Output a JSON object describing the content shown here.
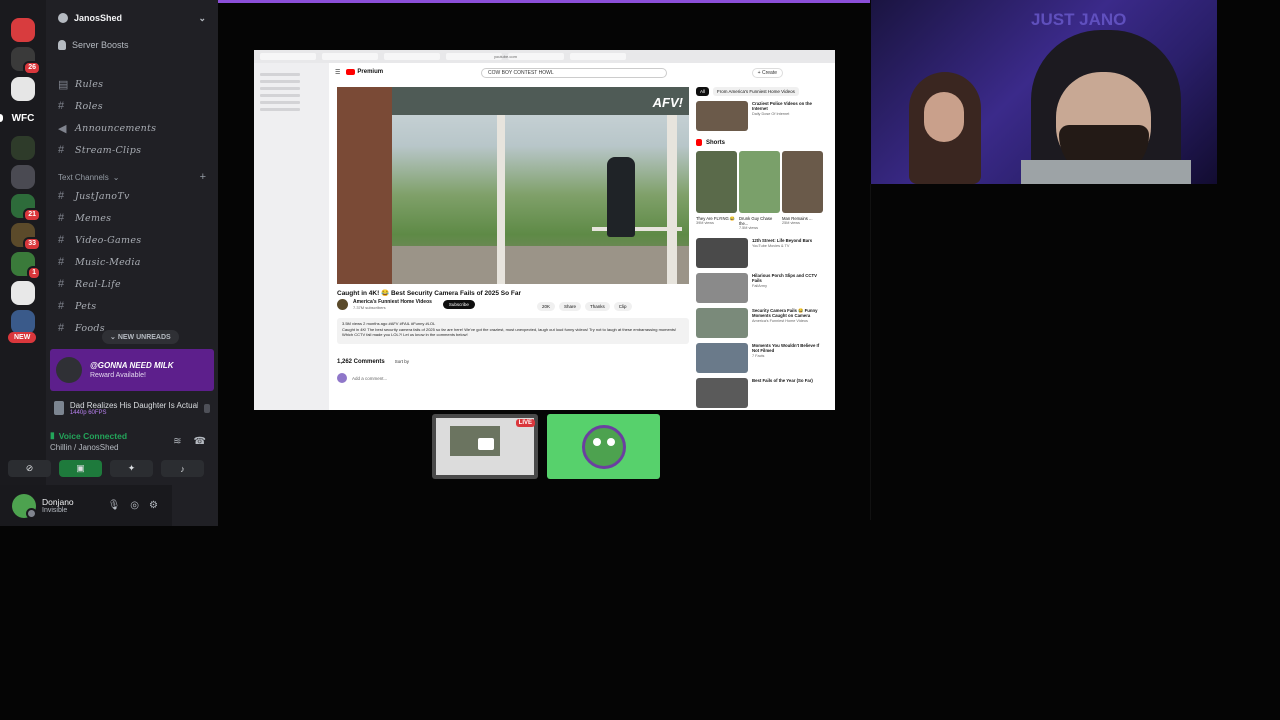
{
  "rail": {
    "servers": [
      {
        "label": "",
        "color": "#d83c3e",
        "badge": ""
      },
      {
        "label": "",
        "color": "#3a3a3a",
        "badge": "26"
      },
      {
        "label": "",
        "color": "#e6e6e6",
        "badge": ""
      },
      {
        "label": "WFC",
        "color": "#1a1a1e",
        "badge": ""
      },
      {
        "label": "",
        "color": "#2e3b2a",
        "badge": ""
      },
      {
        "label": "",
        "color": "#4a4a52",
        "badge": ""
      },
      {
        "label": "",
        "color": "#2d6b3a",
        "badge": "21"
      },
      {
        "label": "",
        "color": "#5b4a2a",
        "badge": "33"
      },
      {
        "label": "",
        "color": "#3a7a3a",
        "badge": "1"
      },
      {
        "label": "",
        "color": "#e8e8e8",
        "badge": ""
      },
      {
        "label": "",
        "color": "#3a5a8a",
        "badge": ""
      }
    ],
    "new_tag": "NEW"
  },
  "sidebar": {
    "server_name": "JanosShed",
    "boosts": "Server Boosts",
    "channels_top": [
      "Rules",
      "Roles",
      "Announcements",
      "Stream-Clips"
    ],
    "category": "Text Channels",
    "channels_text": [
      "JustJanoTv",
      "Memes",
      "Video-Games",
      "Music-Media",
      "Real-Life",
      "Pets",
      "Foods"
    ],
    "new_unreads": "NEW UNREADS",
    "reward_title": "@GONNA NEED MILK",
    "reward_sub": "Reward Available!",
    "activity_title": "Dad Realizes His Daughter Is Actually The...",
    "activity_sub": "1440p 60FPS",
    "voice_status": "Voice Connected",
    "voice_channel": "Chillin / JanosShed",
    "user_name": "Donjano",
    "user_status": "Invisible"
  },
  "browser": {
    "url": "youtube.com",
    "brand": "Premium",
    "search": "COW BOY CONTEST HOWL",
    "create": "+ Create",
    "video_title": "Caught in 4K! 😂 Best Security Camera Fails of 2025 So Far",
    "channel_name": "America's Funniest Home Videos",
    "channel_subs": "7.37M subscribers",
    "subscribe": "Subscribe",
    "actions": [
      "20K",
      "Share",
      "Thanks",
      "Clip"
    ],
    "desc_meta": "3.5M views 2 months ago #AFV #FAIL #Funny #LOL",
    "desc_text": "Caught in 4K! The best security camera fails of 2025 so far are here! We've got the craziest, most unexpected, laugh out loud funny videos! Try not to laugh at these embarrassing moments! Which CCTV fail made you LOL?! Let us know in the comments below!",
    "comments_count": "1,262 Comments",
    "sort_by": "Sort by",
    "add_comment": "Add a comment...",
    "watermark": "AFV!",
    "chips": [
      "All",
      "From America's Funniest Home Videos"
    ],
    "related": [
      {
        "title": "Craziest Police Videos on the Internet",
        "channel": "Daily Dose Of Internet",
        "color": "#6b5a4a"
      },
      {
        "title": "12th Street: Life Beyond Bars",
        "channel": "YouTube Movies & TV",
        "color": "#4a4a4a"
      },
      {
        "title": "Hilarious Porch Slips and CCTV Fails",
        "channel": "FailArmy",
        "color": "#8a8a8a"
      },
      {
        "title": "Security Camera Fails 😂 Funny Moments Caught on Camera",
        "channel": "America's Funniest Home Videos",
        "color": "#7a8a7a"
      },
      {
        "title": "Moments You Wouldn't Believe If Not Filmed",
        "channel": "7 Facts",
        "color": "#6a7a8a"
      },
      {
        "title": "Best Fails of the Year (So Far)",
        "channel": "",
        "color": "#5a5a5a"
      }
    ],
    "shorts_label": "Shorts",
    "shorts": [
      {
        "title": "They Are FLYING 😂",
        "views": "39M views",
        "color": "#5a6a4a"
      },
      {
        "title": "Drunk Guy Chase the...",
        "views": "7.5M views",
        "color": "#7aa06a"
      },
      {
        "title": "Man Remains ...",
        "views": "25M views",
        "color": "#6a5a4a"
      }
    ]
  },
  "tiles": {
    "live": "LIVE"
  },
  "webcam": {
    "sign": "JUST JANO"
  },
  "colors": {
    "accent": "#8b4fd8",
    "voice_green": "#23a55a",
    "youtube_red": "#ff0000"
  }
}
